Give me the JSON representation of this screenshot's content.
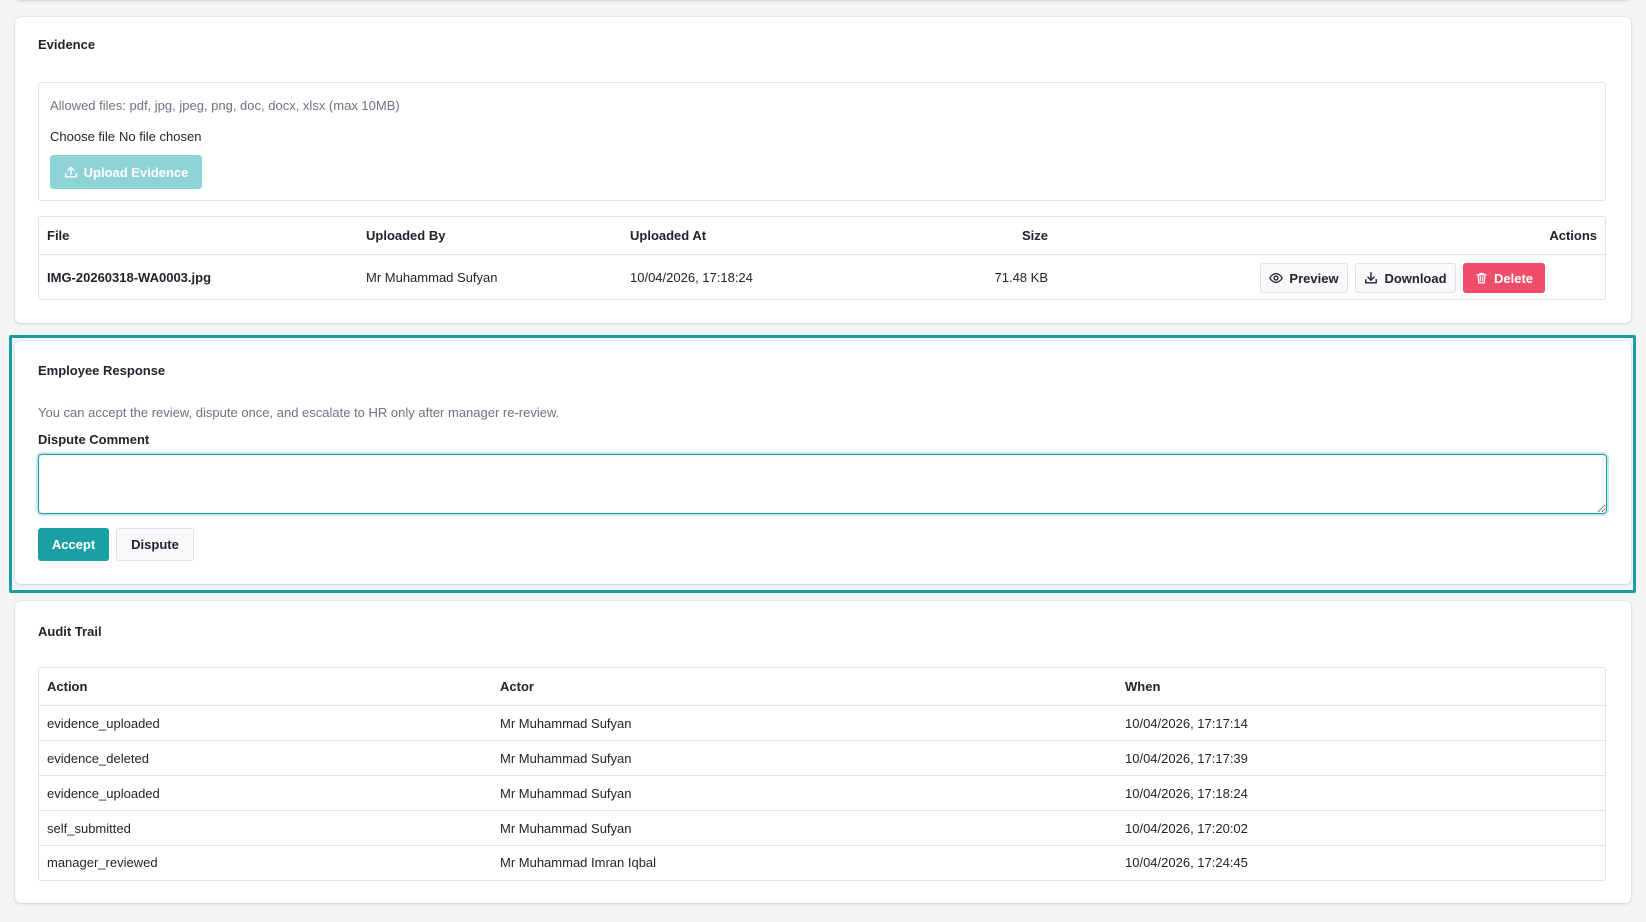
{
  "evidence": {
    "title": "Evidence",
    "allowed_files": "Allowed files: pdf, jpg, jpeg, png, doc, docx, xlsx (max 10MB)",
    "choose_file_label": "Choose file",
    "no_file_text": "No file chosen",
    "upload_button": "Upload Evidence",
    "columns": [
      "File",
      "Uploaded By",
      "Uploaded At",
      "Size",
      "Actions"
    ],
    "rows": [
      {
        "file": "IMG-20260318-WA0003.jpg",
        "uploaded_by": "Mr Muhammad Sufyan",
        "uploaded_at": "10/04/2026, 17:18:24",
        "size": "71.48 KB"
      }
    ],
    "actions": {
      "preview": "Preview",
      "download": "Download",
      "delete": "Delete"
    }
  },
  "response": {
    "title": "Employee Response",
    "hint": "You can accept the review, dispute once, and escalate to HR only after manager re-review.",
    "comment_label": "Dispute Comment",
    "comment_value": "",
    "accept_button": "Accept",
    "dispute_button": "Dispute"
  },
  "audit": {
    "title": "Audit Trail",
    "columns": [
      "Action",
      "Actor",
      "When"
    ],
    "rows": [
      {
        "action": "evidence_uploaded",
        "actor": "Mr Muhammad Sufyan",
        "when": "10/04/2026, 17:17:14"
      },
      {
        "action": "evidence_deleted",
        "actor": "Mr Muhammad Sufyan",
        "when": "10/04/2026, 17:17:39"
      },
      {
        "action": "evidence_uploaded",
        "actor": "Mr Muhammad Sufyan",
        "when": "10/04/2026, 17:18:24"
      },
      {
        "action": "self_submitted",
        "actor": "Mr Muhammad Sufyan",
        "when": "10/04/2026, 17:20:02"
      },
      {
        "action": "manager_reviewed",
        "actor": "Mr Muhammad Imran Iqbal",
        "when": "10/04/2026, 17:24:45"
      }
    ]
  },
  "colors": {
    "accent": "#1aa0a4",
    "accent_light": "#8ed3d5",
    "danger": "#ef4d6a",
    "highlight_border": "#1a9ca0"
  },
  "icons": {
    "upload": "upload-icon",
    "preview": "eye-icon",
    "download": "download-icon",
    "delete": "trash-icon"
  }
}
